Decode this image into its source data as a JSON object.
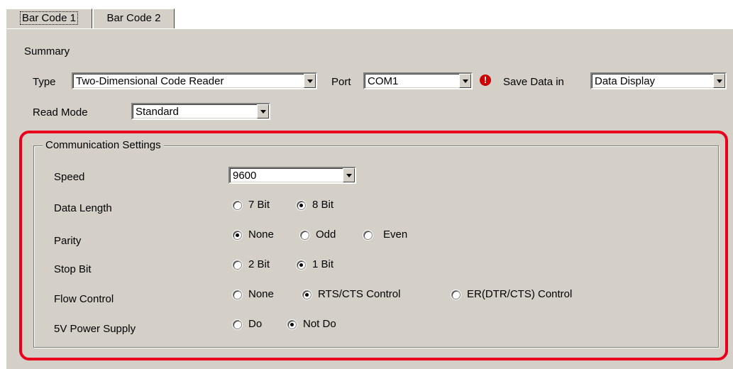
{
  "tabs": [
    {
      "label": "Bar Code 1",
      "active": true
    },
    {
      "label": "Bar Code 2",
      "active": false
    }
  ],
  "summary": {
    "label": "Summary",
    "type_label": "Type",
    "type_value": "Two-Dimensional Code Reader",
    "port_label": "Port",
    "port_value": "COM1",
    "warning_icon": "!",
    "save_label": "Save Data in",
    "save_value": "Data Display",
    "readmode_label": "Read Mode",
    "readmode_value": "Standard"
  },
  "comm": {
    "title": "Communication Settings",
    "speed_label": "Speed",
    "speed_value": "9600",
    "datalength_label": "Data Length",
    "datalength_options": [
      "7 Bit",
      "8 Bit"
    ],
    "datalength_selected": "8 Bit",
    "parity_label": "Parity",
    "parity_options": [
      "None",
      "Odd",
      "Even"
    ],
    "parity_selected": "None",
    "stopbit_label": "Stop Bit",
    "stopbit_options": [
      "2 Bit",
      "1 Bit"
    ],
    "stopbit_selected": "1 Bit",
    "flow_label": "Flow Control",
    "flow_options": [
      "None",
      "RTS/CTS Control",
      "ER(DTR/CTS) Control"
    ],
    "flow_selected": "RTS/CTS Control",
    "power_label": "5V Power Supply",
    "power_options": [
      "Do",
      "Not Do"
    ],
    "power_selected": "Not Do"
  },
  "colors": {
    "highlight": "#e8001c",
    "panel": "#d4d0c8",
    "warning": "#cc0000"
  }
}
